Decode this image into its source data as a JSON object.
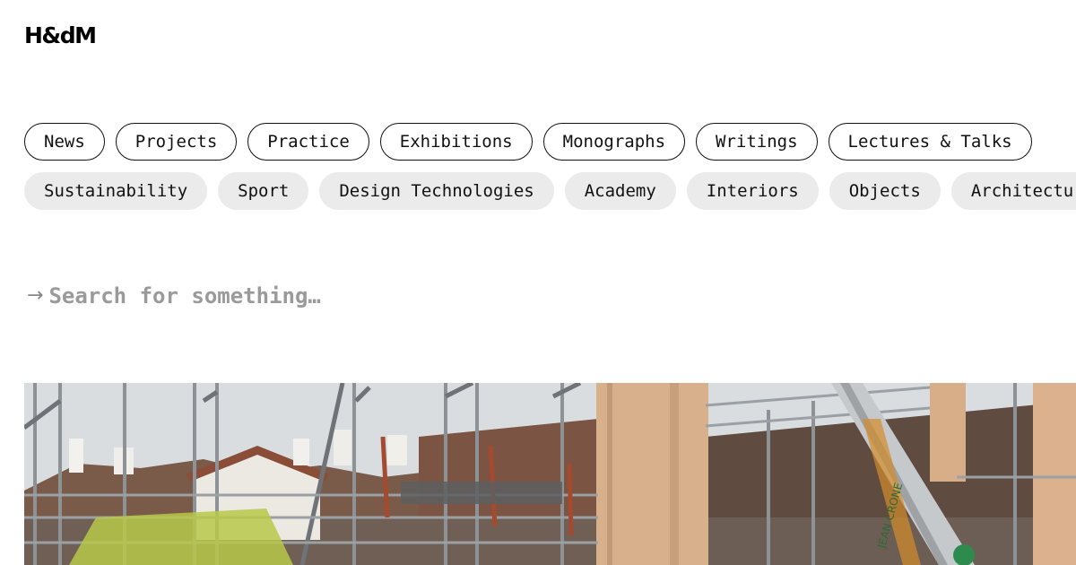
{
  "brand": {
    "logo_text": "H&dM"
  },
  "primary_nav": [
    "News",
    "Projects",
    "Practice",
    "Exhibitions",
    "Monographs",
    "Writings",
    "Lectures & Talks"
  ],
  "topic_tags": [
    "Sustainability",
    "Sport",
    "Design Technologies",
    "Academy",
    "Interiors",
    "Objects",
    "Architecture"
  ],
  "search": {
    "arrow": "→",
    "placeholder": "Search for something…"
  },
  "hero": {
    "ladder_text": "JEAN CRONE"
  },
  "colors": {
    "chip_filled": "#ebebeb",
    "chip_border": "#111111",
    "placeholder": "#9a9a9a"
  }
}
